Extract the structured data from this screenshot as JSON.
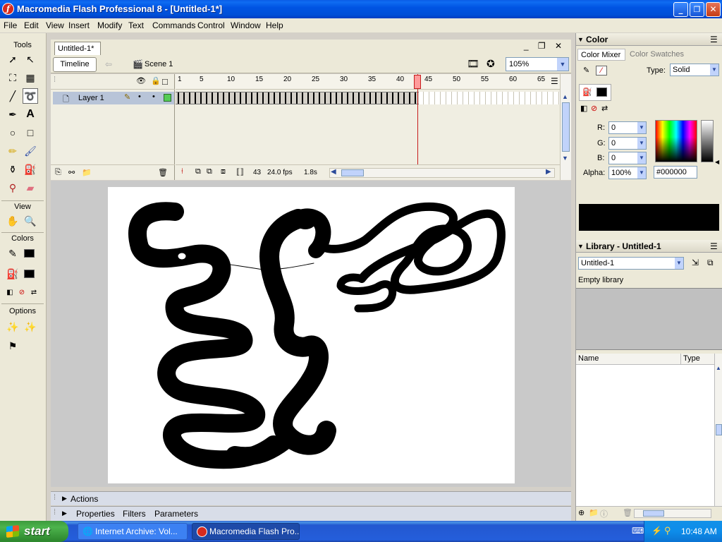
{
  "window": {
    "title": "Macromedia Flash Professional 8 - [Untitled-1*]",
    "controls": [
      "_",
      "❐",
      "✕"
    ]
  },
  "menu": [
    "File",
    "Edit",
    "View",
    "Insert",
    "Modify",
    "Text",
    "Commands",
    "Control",
    "Window",
    "Help"
  ],
  "tools": {
    "heading": "Tools",
    "view_heading": "View",
    "colors_heading": "Colors",
    "options_heading": "Options"
  },
  "document": {
    "tab": "Untitled-1*",
    "timeline_button": "Timeline",
    "scene": "Scene 1",
    "zoom": "105%",
    "layer_name": "Layer 1",
    "ruler": [
      "1",
      "5",
      "10",
      "15",
      "20",
      "25",
      "30",
      "35",
      "40",
      "45",
      "50",
      "55",
      "60",
      "65"
    ],
    "current_frame": "43",
    "fps": "24.0 fps",
    "elapsed": "1.8s"
  },
  "bottom_panels": {
    "actions": "Actions",
    "properties": "Properties",
    "filters": "Filters",
    "parameters": "Parameters"
  },
  "color_panel": {
    "title": "Color",
    "tab_mixer": "Color Mixer",
    "tab_swatches": "Color Swatches",
    "type_label": "Type:",
    "type_value": "Solid",
    "r_label": "R:",
    "r_value": "0",
    "g_label": "G:",
    "g_value": "0",
    "b_label": "B:",
    "b_value": "0",
    "alpha_label": "Alpha:",
    "alpha_value": "100%",
    "hex": "#000000",
    "preview_color": "#000000"
  },
  "library_panel": {
    "title": "Library - Untitled-1",
    "selected_doc": "Untitled-1",
    "status": "Empty library",
    "col_name": "Name",
    "col_type": "Type"
  },
  "taskbar": {
    "start": "start",
    "tasks": [
      "Internet Archive: Vol...",
      "Macromedia Flash Pro..."
    ],
    "clock": "10:48 AM"
  }
}
